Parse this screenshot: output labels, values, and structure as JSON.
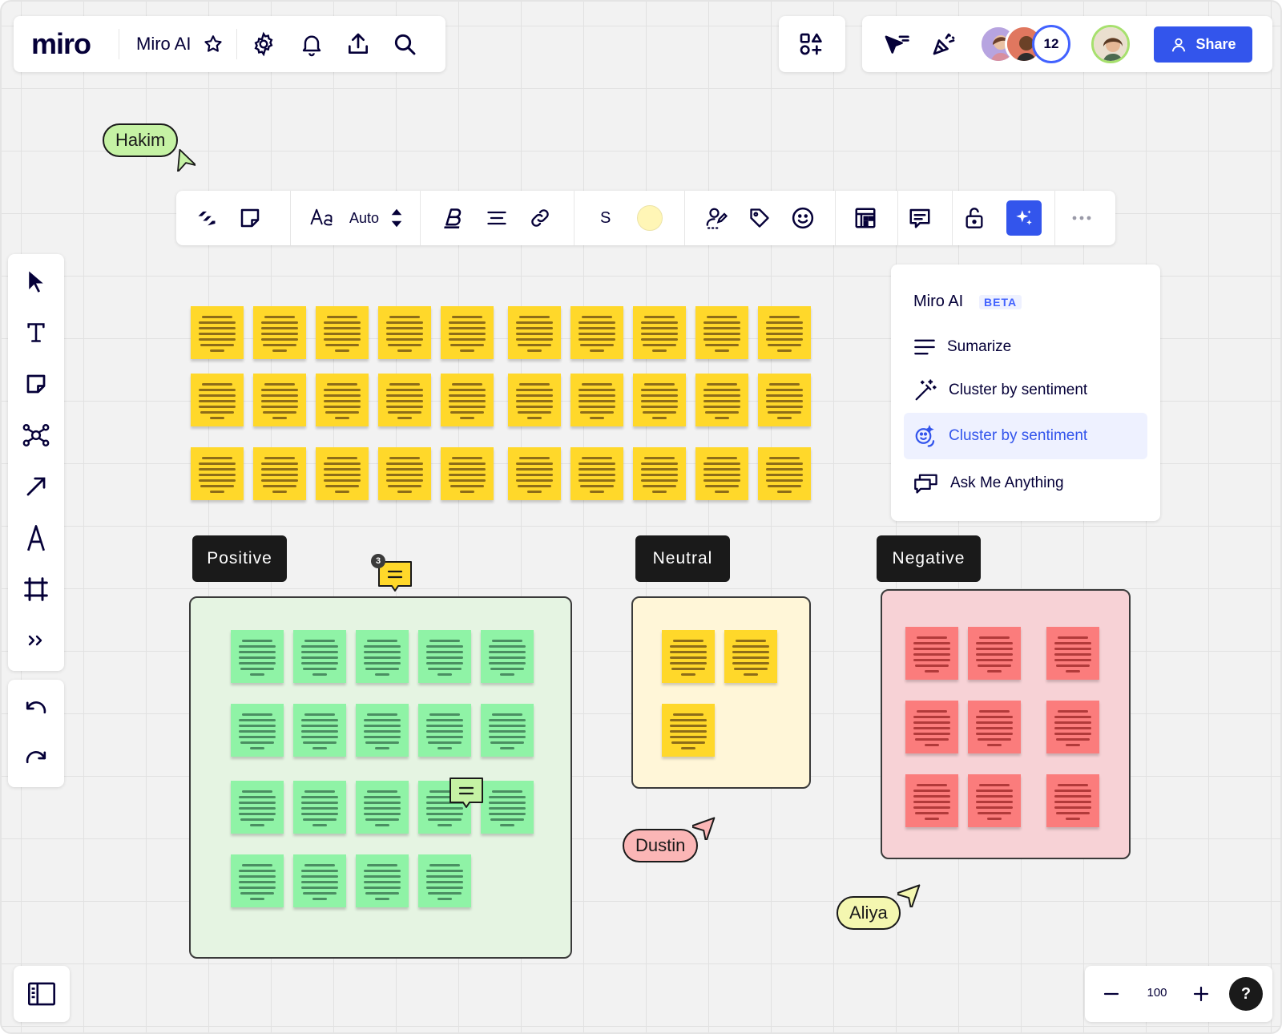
{
  "app": {
    "logo": "miro",
    "board_title": "Miro AI"
  },
  "collaborators": {
    "count": "12",
    "share_label": "Share"
  },
  "context_toolbar": {
    "font_size": "Auto",
    "sticky_size": "S",
    "sticky_color": "#fff6b6",
    "icons": [
      "magic-convert-icon",
      "sticky-note-icon",
      "text-style-icon",
      "bold-icon",
      "align-center-icon",
      "link-icon",
      "assign-icon",
      "tag-icon",
      "emoji-icon",
      "layout-icon",
      "comment-icon",
      "lock-icon",
      "ai-sparkle-icon",
      "more-icon"
    ]
  },
  "ai_menu": {
    "title": "Miro AI",
    "badge": "BETA",
    "items": [
      {
        "label": "Sumarize",
        "icon": "summarize-icon",
        "active": false
      },
      {
        "label": "Cluster by sentiment",
        "icon": "magic-wand-icon",
        "active": false
      },
      {
        "label": "Cluster by sentiment",
        "icon": "sentiment-icon",
        "active": true
      },
      {
        "label": "Ask Me Anything",
        "icon": "chat-icon",
        "active": false
      }
    ]
  },
  "clusters": {
    "positive": "Positive",
    "neutral": "Neutral",
    "negative": "Negative"
  },
  "cursors": {
    "hakim": "Hakim",
    "dustin": "Dustin",
    "aliya": "Aliya"
  },
  "comments": {
    "thread_count": "3"
  },
  "zoom": {
    "value": "100",
    "help": "?"
  },
  "colors": {
    "accent": "#3355ec",
    "sticky_yellow": "#ffd82a",
    "sticky_green": "#8ff3a6",
    "sticky_red": "#fb7c7c",
    "positive_bg": "#e5f4e2",
    "neutral_bg": "#fff6d8",
    "negative_bg": "#f7d2d6"
  }
}
